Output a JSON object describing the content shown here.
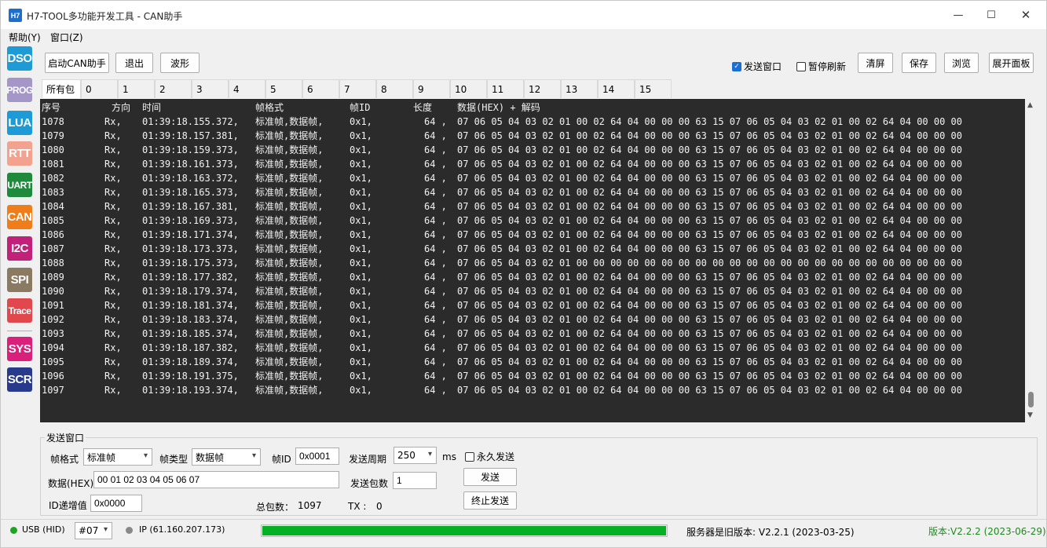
{
  "window": {
    "icon_text": "H7",
    "title": "H7-TOOL多功能开发工具 - CAN助手",
    "min": "—",
    "max": "☐",
    "close": "✕"
  },
  "menu": [
    "帮助(Y)",
    "窗口(Z)"
  ],
  "sidebar": [
    {
      "label": "DSO",
      "color": "#1e9ad6"
    },
    {
      "label": "PROG",
      "color": "#a596c8"
    },
    {
      "label": "LUA",
      "color": "#1e9ad6"
    },
    {
      "label": "RTT",
      "color": "#f2a28e"
    },
    {
      "label": "UART",
      "color": "#1f8a3c"
    },
    {
      "label": "CAN",
      "color": "#ef7d1a"
    },
    {
      "label": "I2C",
      "color": "#c2217a"
    },
    {
      "label": "SPI",
      "color": "#8a7a62"
    },
    {
      "label": "Trace",
      "color": "#e0484e"
    },
    {
      "label": "SYS",
      "color": "#d9207a"
    },
    {
      "label": "SCR",
      "color": "#273a8c"
    }
  ],
  "toolbar": {
    "start_can": "启动CAN助手",
    "exit": "退出",
    "wave": "波形",
    "send_window": "发送窗口",
    "send_window_checked": true,
    "pause_refresh": "暂停刷新",
    "pause_refresh_checked": false,
    "clear": "清屏",
    "save": "保存",
    "browse": "浏览",
    "expand_panel": "展开面板"
  },
  "tabs": [
    "所有包",
    "0",
    "1",
    "2",
    "3",
    "4",
    "5",
    "6",
    "7",
    "8",
    "9",
    "10",
    "11",
    "12",
    "13",
    "14",
    "15"
  ],
  "log": {
    "header": {
      "seq": "序号",
      "dir": "方向",
      "time": "时间",
      "format": "帧格式",
      "id": "帧ID",
      "len": "长度",
      "data": "数据(HEX) + 解码"
    },
    "dir_value": "Rx,",
    "format_value": "标准帧,数据帧,",
    "id_value": "0x1,",
    "len_value": "64 ,",
    "data_normal": "07 06 05 04 03 02 01 00 02 64 04 00 00 00 63 15 07 06 05 04 03 02 01 00 02 64 04 00 00 00",
    "data_alt": "07 06 05 04 03 02 01 00 00 00 00 00 00 00 00 00 00 00 00 00 00 00 00 00 00 00 00 00 00 00",
    "rows": [
      {
        "seq": "1078",
        "time": "01:39:18.155.372,",
        "alt": false
      },
      {
        "seq": "1079",
        "time": "01:39:18.157.381,",
        "alt": false
      },
      {
        "seq": "1080",
        "time": "01:39:18.159.373,",
        "alt": false
      },
      {
        "seq": "1081",
        "time": "01:39:18.161.373,",
        "alt": false
      },
      {
        "seq": "1082",
        "time": "01:39:18.163.372,",
        "alt": false
      },
      {
        "seq": "1083",
        "time": "01:39:18.165.373,",
        "alt": false
      },
      {
        "seq": "1084",
        "time": "01:39:18.167.381,",
        "alt": false
      },
      {
        "seq": "1085",
        "time": "01:39:18.169.373,",
        "alt": false
      },
      {
        "seq": "1086",
        "time": "01:39:18.171.374,",
        "alt": false
      },
      {
        "seq": "1087",
        "time": "01:39:18.173.373,",
        "alt": false
      },
      {
        "seq": "1088",
        "time": "01:39:18.175.373,",
        "alt": true
      },
      {
        "seq": "1089",
        "time": "01:39:18.177.382,",
        "alt": false
      },
      {
        "seq": "1090",
        "time": "01:39:18.179.374,",
        "alt": false
      },
      {
        "seq": "1091",
        "time": "01:39:18.181.374,",
        "alt": false
      },
      {
        "seq": "1092",
        "time": "01:39:18.183.374,",
        "alt": false
      },
      {
        "seq": "1093",
        "time": "01:39:18.185.374,",
        "alt": false
      },
      {
        "seq": "1094",
        "time": "01:39:18.187.382,",
        "alt": false
      },
      {
        "seq": "1095",
        "time": "01:39:18.189.374,",
        "alt": false
      },
      {
        "seq": "1096",
        "time": "01:39:18.191.375,",
        "alt": false
      },
      {
        "seq": "1097",
        "time": "01:39:18.193.374,",
        "alt": false
      }
    ]
  },
  "send": {
    "group_title": "发送窗口",
    "frame_format_label": "帧格式",
    "frame_format_value": "标准帧",
    "frame_type_label": "帧类型",
    "frame_type_value": "数据帧",
    "frame_id_label": "帧ID",
    "frame_id_value": "0x0001",
    "period_label": "发送周期",
    "period_value": "250",
    "period_unit": "ms",
    "forever_label": "永久发送",
    "forever_checked": false,
    "data_label": "数据(HEX)",
    "data_value": "00 01 02 03 04 05 06 07",
    "count_label": "发送包数",
    "count_value": "1",
    "send_button": "发送",
    "stop_button": "终止发送",
    "id_inc_label": "ID递增值",
    "id_inc_value": "0x0000",
    "total_label": "总包数：",
    "total_value": "1097",
    "tx_label": "TX :",
    "tx_value": "0"
  },
  "status": {
    "usb": "USB (HID)",
    "usb_color": "#1ea51e",
    "device": "#07",
    "ip": "IP (61.160.207.173)",
    "ip_color": "#888888",
    "progress_fraction": 1.0,
    "server_version": "服务器是旧版本: V2.2.1 (2023-03-25)",
    "local_version": "版本:V2.2.2 (2023-06-29)",
    "local_version_color": "#1e8a1e"
  }
}
